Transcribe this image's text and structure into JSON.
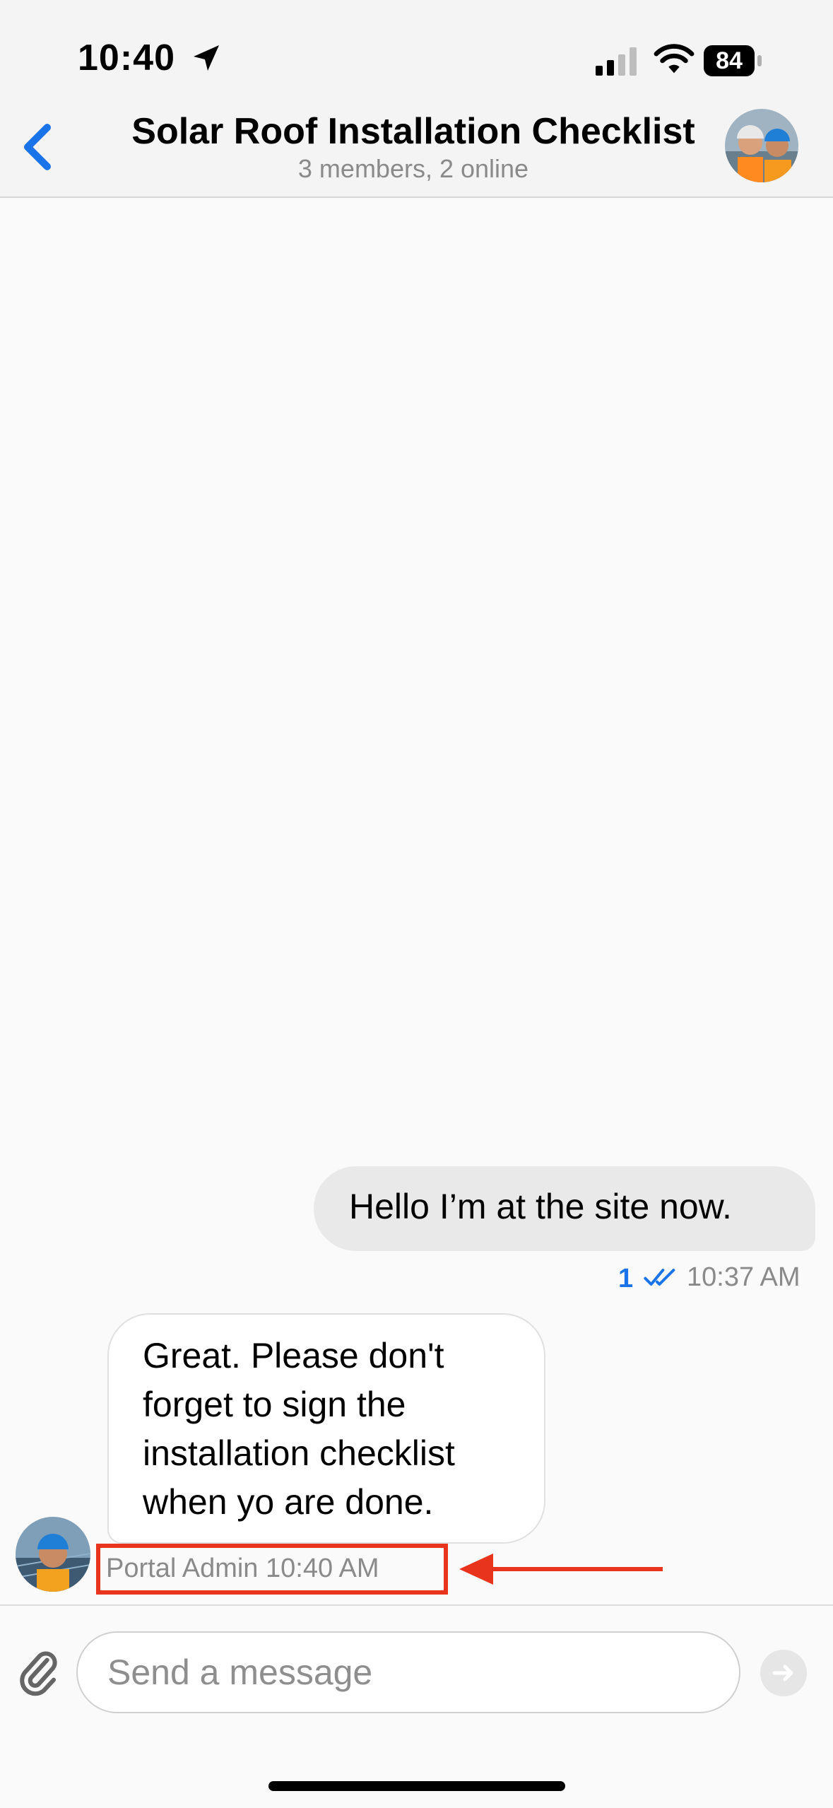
{
  "status_bar": {
    "time": "10:40",
    "battery": "84",
    "icons": [
      "location-arrow-icon",
      "cellular-signal-icon",
      "wifi-icon",
      "battery-icon"
    ]
  },
  "header": {
    "title": "Solar Roof Installation Checklist",
    "subtitle": "3 members, 2 online",
    "back_icon": "chevron-left-icon",
    "accent_color": "#1a73e8"
  },
  "messages": [
    {
      "direction": "outgoing",
      "text": "Hello I’m at the site now.",
      "read_count": "1",
      "status_icon": "double-check-icon",
      "time": "10:37 AM"
    },
    {
      "direction": "incoming",
      "text": "Great. Please don't forget to sign the installation checklist when yo are done.",
      "sender_label": "Portal Admin 10:40 AM"
    }
  ],
  "annotation": {
    "color": "#e8341c",
    "highlight": "sender-label-box",
    "pointer": "red-arrow"
  },
  "composer": {
    "placeholder": "Send a message",
    "value": "",
    "attach_icon": "paperclip-icon",
    "send_icon": "arrow-right-icon"
  }
}
